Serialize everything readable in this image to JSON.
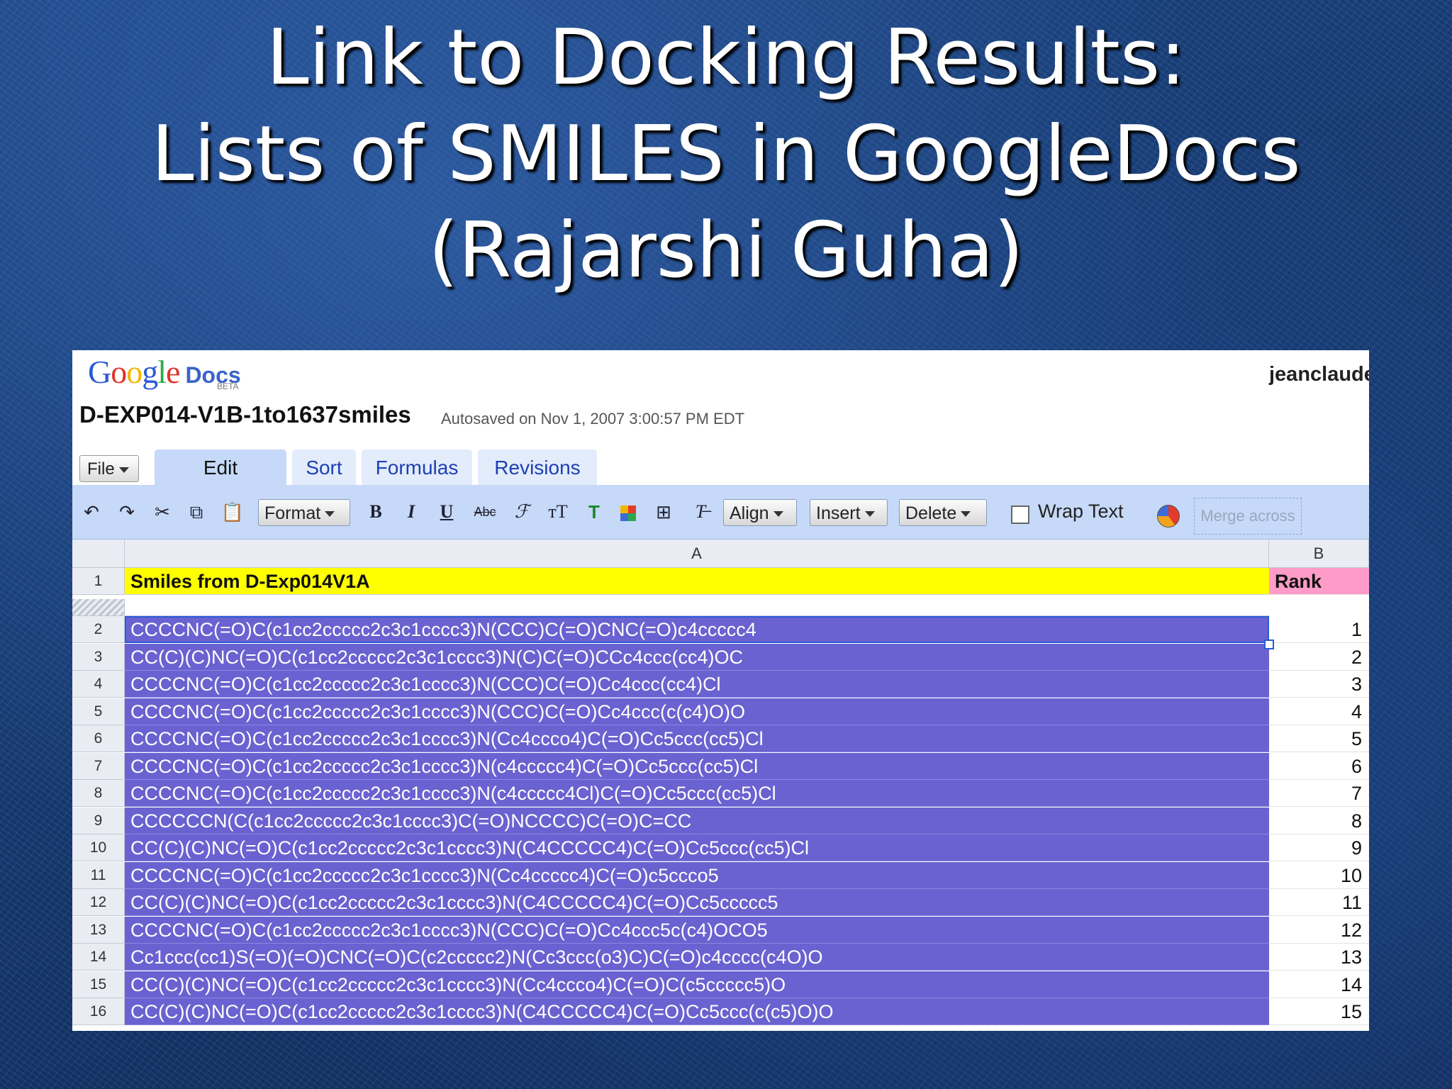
{
  "slide": {
    "title_lines": [
      "Link to Docking Results:",
      "Lists of SMILES in GoogleDocs",
      "(Rajarshi Guha)"
    ]
  },
  "app": {
    "logo_text": "Google",
    "logo_docs": "Docs",
    "logo_beta": "BETA",
    "user": "jeanclaude",
    "doc_name": "D-EXP014-V1B-1to1637smiles",
    "autosave": "Autosaved on Nov 1, 2007 3:00:57 PM EDT"
  },
  "menu": {
    "file": "File",
    "tabs": [
      "Edit",
      "Sort",
      "Formulas",
      "Revisions"
    ],
    "active_tab": "Edit"
  },
  "toolbar": {
    "format": "Format",
    "align": "Align",
    "insert": "Insert",
    "delete": "Delete",
    "wrap_text": "Wrap Text",
    "merge_across": "Merge across",
    "icons": [
      "undo-icon",
      "redo-icon",
      "cut-icon",
      "copy-icon",
      "paste-icon",
      "bold-icon",
      "italic-icon",
      "underline-icon",
      "strikethrough-icon",
      "font-icon",
      "font-size-icon",
      "text-color-icon",
      "background-color-icon",
      "borders-icon",
      "clear-format-icon",
      "chart-icon"
    ]
  },
  "sheet": {
    "columns": [
      "A",
      "B"
    ],
    "header_row": {
      "num": "1",
      "a": "Smiles from D-Exp014V1A",
      "b": "Rank"
    },
    "rows": [
      {
        "num": "2",
        "smiles": "CCCCNC(=O)C(c1cc2ccccc2c3c1cccc3)N(CCC)C(=O)CNC(=O)c4ccccc4",
        "rank": "1"
      },
      {
        "num": "3",
        "smiles": "CC(C)(C)NC(=O)C(c1cc2ccccc2c3c1cccc3)N(C)C(=O)CCc4ccc(cc4)OC",
        "rank": "2"
      },
      {
        "num": "4",
        "smiles": "CCCCNC(=O)C(c1cc2ccccc2c3c1cccc3)N(CCC)C(=O)Cc4ccc(cc4)Cl",
        "rank": "3"
      },
      {
        "num": "5",
        "smiles": "CCCCNC(=O)C(c1cc2ccccc2c3c1cccc3)N(CCC)C(=O)Cc4ccc(c(c4)O)O",
        "rank": "4"
      },
      {
        "num": "6",
        "smiles": "CCCCNC(=O)C(c1cc2ccccc2c3c1cccc3)N(Cc4ccco4)C(=O)Cc5ccc(cc5)Cl",
        "rank": "5"
      },
      {
        "num": "7",
        "smiles": "CCCCNC(=O)C(c1cc2ccccc2c3c1cccc3)N(c4ccccc4)C(=O)Cc5ccc(cc5)Cl",
        "rank": "6"
      },
      {
        "num": "8",
        "smiles": "CCCCNC(=O)C(c1cc2ccccc2c3c1cccc3)N(c4ccccc4Cl)C(=O)Cc5ccc(cc5)Cl",
        "rank": "7"
      },
      {
        "num": "9",
        "smiles": "CCCCCCN(C(c1cc2ccccc2c3c1cccc3)C(=O)NCCCC)C(=O)C=CC",
        "rank": "8"
      },
      {
        "num": "10",
        "smiles": "CC(C)(C)NC(=O)C(c1cc2ccccc2c3c1cccc3)N(C4CCCCC4)C(=O)Cc5ccc(cc5)Cl",
        "rank": "9"
      },
      {
        "num": "11",
        "smiles": "CCCCNC(=O)C(c1cc2ccccc2c3c1cccc3)N(Cc4ccccc4)C(=O)c5ccco5",
        "rank": "10"
      },
      {
        "num": "12",
        "smiles": "CC(C)(C)NC(=O)C(c1cc2ccccc2c3c1cccc3)N(C4CCCCC4)C(=O)Cc5ccccc5",
        "rank": "11"
      },
      {
        "num": "13",
        "smiles": "CCCCNC(=O)C(c1cc2ccccc2c3c1cccc3)N(CCC)C(=O)Cc4ccc5c(c4)OCO5",
        "rank": "12"
      },
      {
        "num": "14",
        "smiles": "Cc1ccc(cc1)S(=O)(=O)CNC(=O)C(c2ccccc2)N(Cc3ccc(o3)C)C(=O)c4cccc(c4O)O",
        "rank": "13"
      },
      {
        "num": "15",
        "smiles": "CC(C)(C)NC(=O)C(c1cc2ccccc2c3c1cccc3)N(Cc4ccco4)C(=O)C(c5ccccc5)O",
        "rank": "14"
      },
      {
        "num": "16",
        "smiles": "CC(C)(C)NC(=O)C(c1cc2ccccc2c3c1cccc3)N(C4CCCCC4)C(=O)Cc5ccc(c(c5)O)O",
        "rank": "15"
      }
    ]
  },
  "colors": {
    "header_a": "#ffff00",
    "header_b": "#ff9bc8",
    "selection": "#6a62d0",
    "toolbar": "#c6d9f8"
  }
}
